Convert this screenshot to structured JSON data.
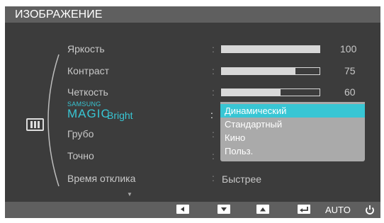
{
  "window": {
    "title": "ИЗОБРАЖЕНИЕ"
  },
  "menu": {
    "brightness": {
      "label": "Яркость",
      "value": "100",
      "level": 1.0
    },
    "contrast": {
      "label": "Контраст",
      "value": "75",
      "level": 0.75
    },
    "sharpness": {
      "label": "Четкость",
      "value": "60",
      "level": 0.6
    },
    "magic_bright": {
      "brand_small": "SAMSUNG",
      "brand_large": "MAGIC",
      "label": "Bright"
    },
    "coarse": {
      "label": "Грубо"
    },
    "fine": {
      "label": "Точно"
    },
    "response_time": {
      "label": "Время отклика",
      "value": "Быстрее"
    }
  },
  "colon": ":",
  "dropdown": {
    "selected_index": 0,
    "options": [
      "Динамический",
      "Стандартный",
      "Кино",
      "Польз."
    ]
  },
  "scroll_indicator": "▼",
  "bottom_bar": {
    "auto_label": "AUTO"
  },
  "colors": {
    "accent": "#38c6d4",
    "background": "#3c3c3c",
    "bar": "#5f5f5f"
  },
  "icons": [
    "picture-icon",
    "left-arrow-icon",
    "down-arrow-icon",
    "up-arrow-icon",
    "enter-icon",
    "power-icon"
  ]
}
